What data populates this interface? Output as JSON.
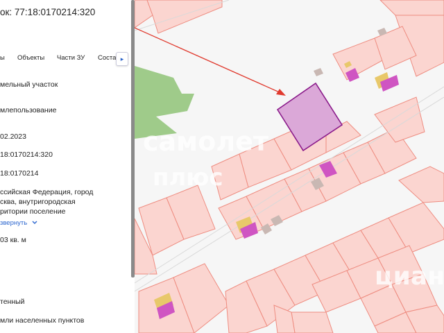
{
  "panel": {
    "title": "ок: 77:18:0170214:320",
    "tabs": [
      "ы",
      "Объекты",
      "Части ЗУ",
      "Соста"
    ],
    "tab_more_label": "▸",
    "fields": {
      "type": "мельный участок",
      "usage": "млепользование",
      "date": "02.2023",
      "cadastral_number": "18:0170214:320",
      "quarter": "18:0170214",
      "address": "ссийская Федерация, город\nсква, внутригородская\nритории поселение",
      "expand_link": "звернуть",
      "area": "03 кв. м",
      "status": "тенный",
      "category": "мли населенных пунктов"
    }
  },
  "map": {
    "watermark_1": "самолет",
    "watermark_2": "плюс",
    "watermark_3": "циан",
    "colors": {
      "parcel_fill": "#fbd5d0",
      "parcel_stroke": "#ee8c80",
      "selected_fill": "#dba8d8",
      "selected_stroke": "#8a1a8a",
      "building": "#cf55c2",
      "forest": "#9fcb8a",
      "annotation_arrow": "#e03a2e"
    }
  }
}
